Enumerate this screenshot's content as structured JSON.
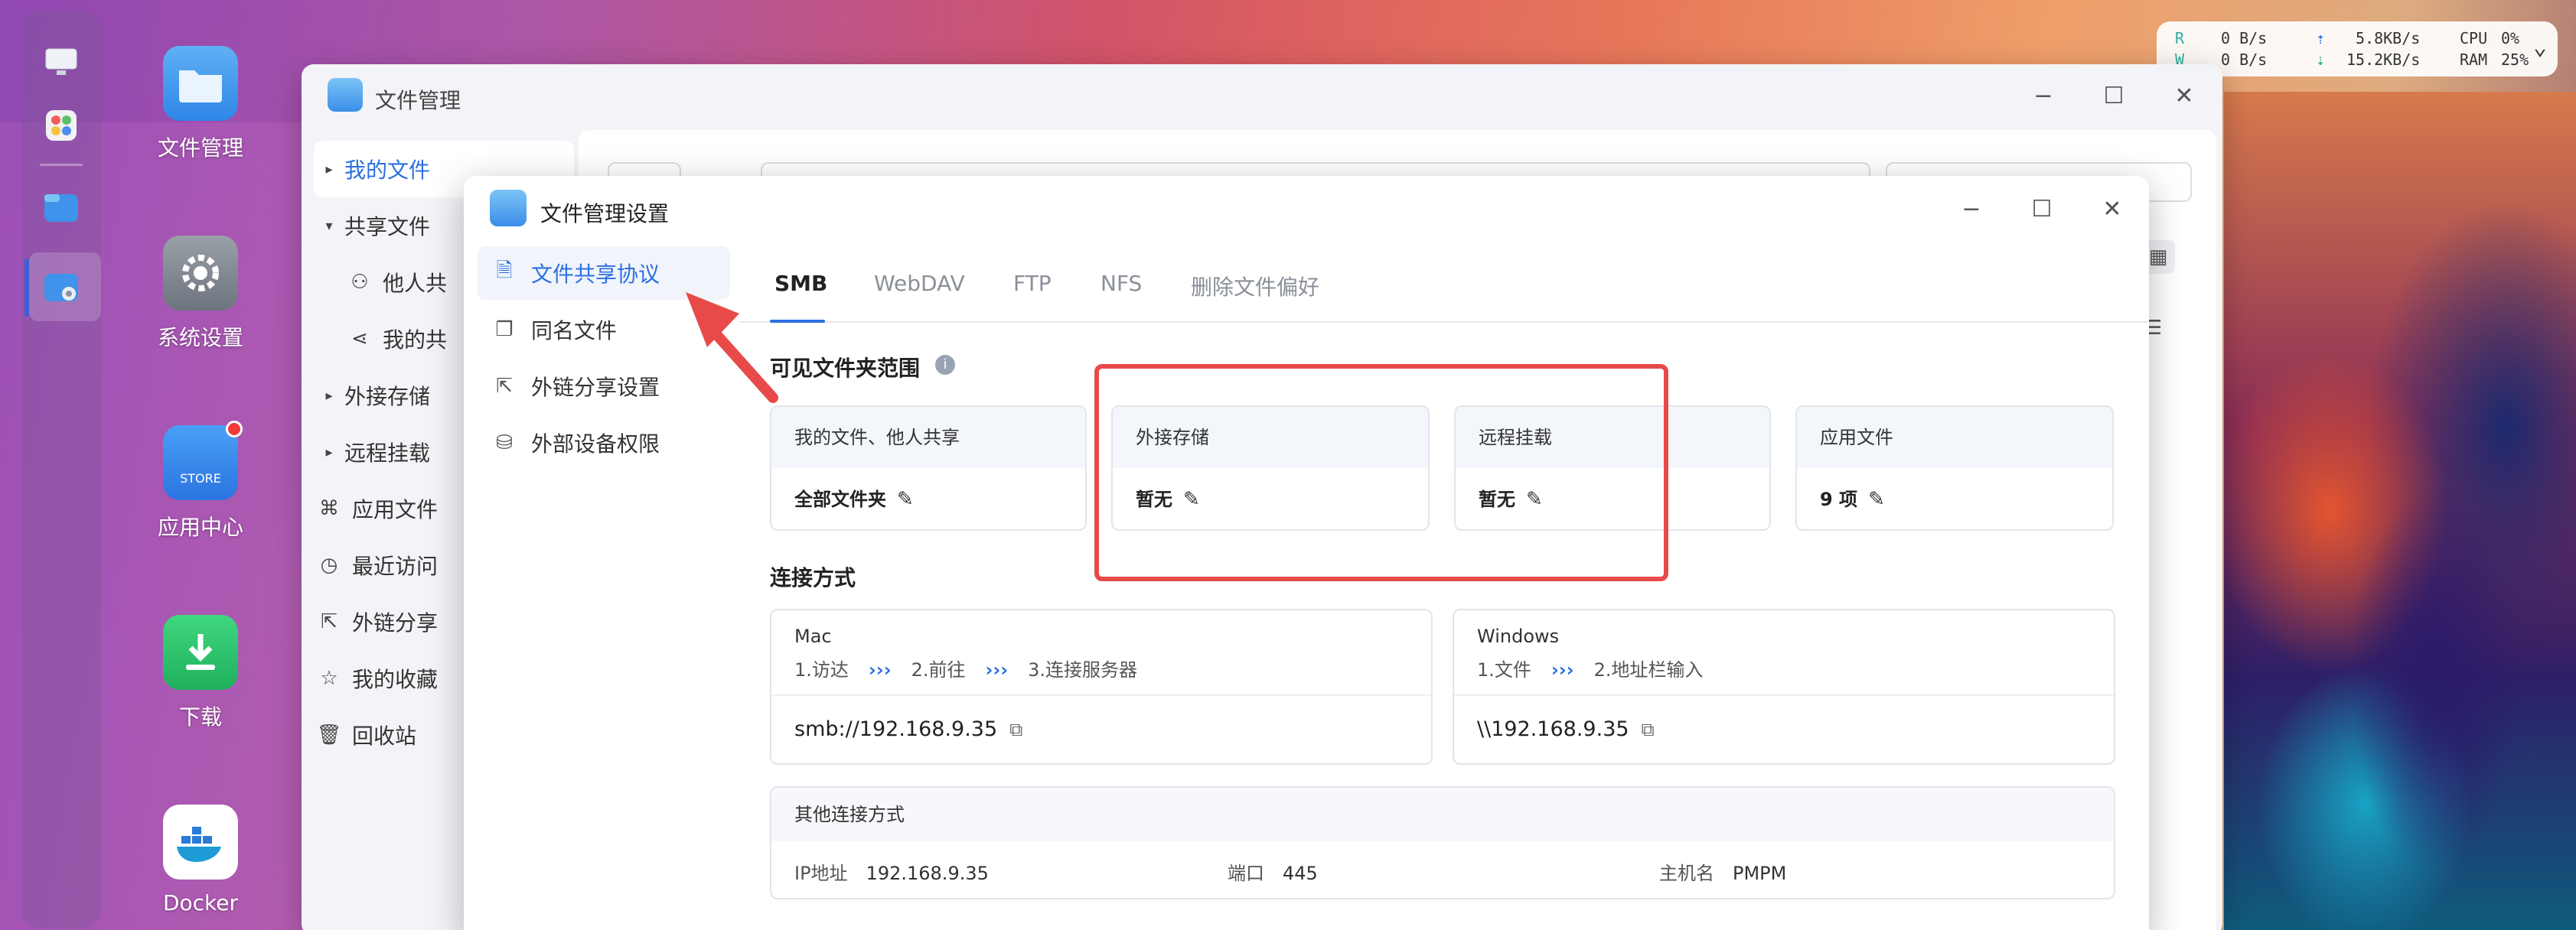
{
  "desktop": {
    "icons": [
      {
        "label": "文件管理"
      },
      {
        "label": "系统设置"
      },
      {
        "label": "应用中心",
        "badge_text": "STORE"
      },
      {
        "label": "下载"
      },
      {
        "label": "Docker"
      }
    ]
  },
  "status_widget": {
    "read_label": "R",
    "write_label": "W",
    "read_speed": "0 B/s",
    "write_speed": "0 B/s",
    "up_speed": "5.8KB/s",
    "down_speed": "15.2KB/s",
    "cpu_label": "CPU",
    "cpu_value": "0%",
    "ram_label": "RAM",
    "ram_value": "25%"
  },
  "file_manager": {
    "title": "文件管理",
    "sidebar": [
      {
        "label": "我的文件",
        "active": true
      },
      {
        "label": "共享文件"
      },
      {
        "label": "他人共"
      },
      {
        "label": "我的共"
      },
      {
        "label": "外接存储"
      },
      {
        "label": "远程挂载"
      },
      {
        "label": "应用文件"
      },
      {
        "label": "最近访问"
      },
      {
        "label": "外链分享"
      },
      {
        "label": "我的收藏"
      },
      {
        "label": "回收站"
      }
    ]
  },
  "settings_dialog": {
    "title": "文件管理设置",
    "sidebar": [
      {
        "label": "文件共享协议",
        "active": true
      },
      {
        "label": "同名文件"
      },
      {
        "label": "外链分享设置"
      },
      {
        "label": "外部设备权限"
      }
    ],
    "tabs": [
      "SMB",
      "WebDAV",
      "FTP",
      "NFS",
      "删除文件偏好"
    ],
    "visible_scope": {
      "title": "可见文件夹范围",
      "cards": [
        {
          "head": "我的文件、他人共享",
          "value": "全部文件夹"
        },
        {
          "head": "外接存储",
          "value": "暂无"
        },
        {
          "head": "远程挂载",
          "value": "暂无"
        },
        {
          "head": "应用文件",
          "value": "9 项"
        }
      ]
    },
    "connection": {
      "title": "连接方式",
      "mac": {
        "name": "Mac",
        "steps": [
          "1.访达",
          "2.前往",
          "3.连接服务器"
        ],
        "address": "smb://192.168.9.35"
      },
      "windows": {
        "name": "Windows",
        "steps": [
          "1.文件",
          "2.地址栏输入"
        ],
        "address": "\\\\192.168.9.35"
      },
      "other": {
        "title": "其他连接方式",
        "ip_label": "IP地址",
        "ip_value": "192.168.9.35",
        "port_label": "端口",
        "port_value": "445",
        "host_label": "主机名",
        "host_value": "PMPM"
      }
    }
  },
  "colors": {
    "accent": "#2b6fe0",
    "annotation": "#e84a4a"
  }
}
